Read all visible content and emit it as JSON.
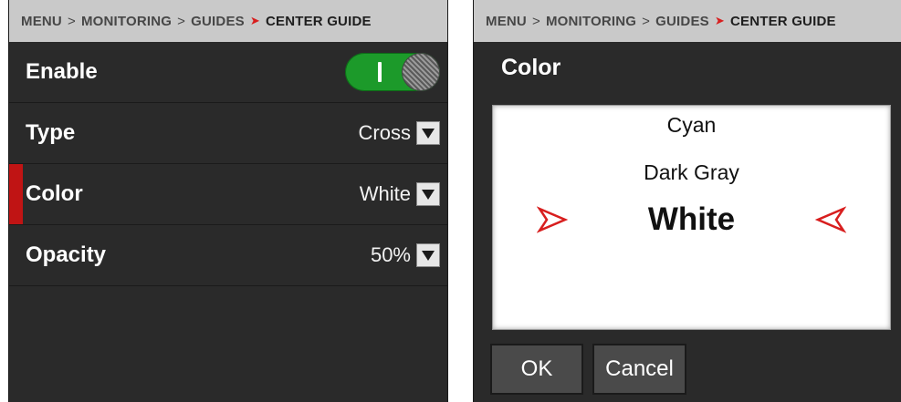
{
  "left_panel": {
    "breadcrumb": [
      "MENU",
      "MONITORING",
      "GUIDES",
      "CENTER GUIDE"
    ],
    "rows": [
      {
        "label": "Enable",
        "toggle": "on"
      },
      {
        "label": "Type",
        "value": "Cross"
      },
      {
        "label": "Color",
        "value": "White",
        "selected": true
      },
      {
        "label": "Opacity",
        "value": "50%"
      }
    ]
  },
  "right_panel": {
    "breadcrumb": [
      "MENU",
      "MONITORING",
      "GUIDES",
      "CENTER GUIDE"
    ],
    "title": "Color",
    "options": [
      "Cyan",
      "Dark Gray",
      "White"
    ],
    "selected_option": "White",
    "buttons": {
      "ok": "OK",
      "cancel": "Cancel"
    }
  },
  "colors": {
    "accent_red": "#d81e1e",
    "toggle_on": "#1c9a2a",
    "panel_bg": "#2a2a2a",
    "breadcrumb_bg": "#c9c9c9"
  },
  "icons": [
    "chevron-down-icon",
    "picker-arrow-right-icon",
    "picker-arrow-left-icon",
    "toggle-knob-icon"
  ]
}
